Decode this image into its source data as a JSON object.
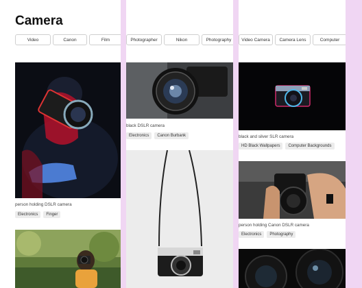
{
  "page": {
    "title": "Camera"
  },
  "tabs": [
    {
      "label": "Video"
    },
    {
      "label": "Canon"
    },
    {
      "label": "Film"
    },
    {
      "label": "Photographer"
    },
    {
      "label": "Nikon"
    },
    {
      "label": "Photography"
    },
    {
      "label": "Video Camera"
    },
    {
      "label": "Camera Lens"
    },
    {
      "label": "Computer"
    }
  ],
  "photos": [
    {
      "caption": "person holding DSLR camera",
      "tags": [
        "Electronics",
        "Finger"
      ]
    },
    {
      "caption": "",
      "tags": []
    },
    {
      "caption": "black DSLR camera",
      "tags": [
        "Electronics",
        "Canon Burbank"
      ]
    },
    {
      "caption": "",
      "tags": []
    },
    {
      "caption": "black and silver SLR camera",
      "tags": [
        "HD Black Wallpapers",
        "Computer Backgrounds"
      ]
    },
    {
      "caption": "person holding Canon DSLR camera",
      "tags": [
        "Electronics",
        "Photography"
      ]
    },
    {
      "caption": "",
      "tags": []
    }
  ]
}
